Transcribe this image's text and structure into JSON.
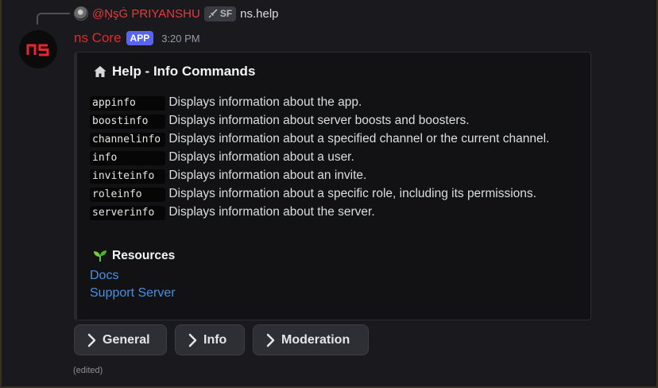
{
  "reply": {
    "username": "@ŅşĠ PRIYANSHU",
    "tag": "SF",
    "text": "ns.help",
    "reply_icon": "user-avatar-icon",
    "tag_icon": "sword-icon"
  },
  "message": {
    "author": "ns Core",
    "badge": "APP",
    "time": "3:20 PM",
    "avatar_text": "ns",
    "edited": "(edited)"
  },
  "embed": {
    "title": "Help - Info Commands",
    "title_icon": "home-icon",
    "commands": [
      {
        "name": "appinfo",
        "desc": "Displays information about the app."
      },
      {
        "name": "boostinfo",
        "desc": "Displays information about server boosts and boosters."
      },
      {
        "name": "channelinfo",
        "desc": "Displays information about a specified channel or the current channel."
      },
      {
        "name": "info",
        "desc": "Displays information about a user."
      },
      {
        "name": "inviteinfo",
        "desc": "Displays information about an invite."
      },
      {
        "name": "roleinfo",
        "desc": "Displays information about a specific role, including its permissions."
      },
      {
        "name": "serverinfo",
        "desc": "Displays information about the server."
      }
    ],
    "resources_title": "Resources",
    "resources_icon": "seedling-icon",
    "links": [
      "Docs",
      "Support Server"
    ]
  },
  "buttons": [
    "General",
    "Info",
    "Moderation"
  ],
  "colors": {
    "author": "#e8262b",
    "app_badge": "#5865f2",
    "link": "#4a90e2",
    "reply_user": "#e23b3b"
  }
}
